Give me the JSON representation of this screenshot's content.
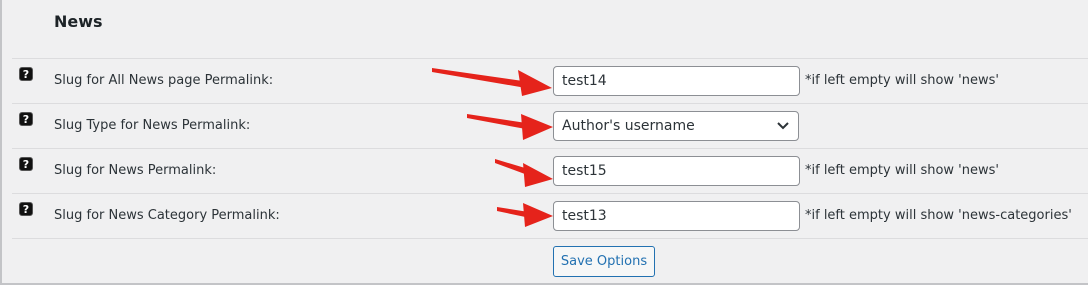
{
  "section": {
    "title": "News"
  },
  "rows": [
    {
      "label": "Slug for All News page Permalink:",
      "value": "test14",
      "hint": "*if left empty will show 'news'"
    },
    {
      "label": "Slug Type for News Permalink:",
      "selected": "Author's username"
    },
    {
      "label": "Slug for News Permalink:",
      "value": "test15",
      "hint": "*if left empty will show 'news'"
    },
    {
      "label": "Slug for News Category Permalink:",
      "value": "test13",
      "hint": "*if left empty will show 'news-categories'"
    }
  ],
  "help_icon_glyph": "?",
  "save_button": {
    "label": "Save Options"
  },
  "colors": {
    "accent": "#2271b1",
    "annotation_arrow": "#e5231b",
    "background": "#f0f0f1"
  },
  "icons": [
    "help-icon",
    "chevron-down-icon",
    "annotation-arrow"
  ]
}
